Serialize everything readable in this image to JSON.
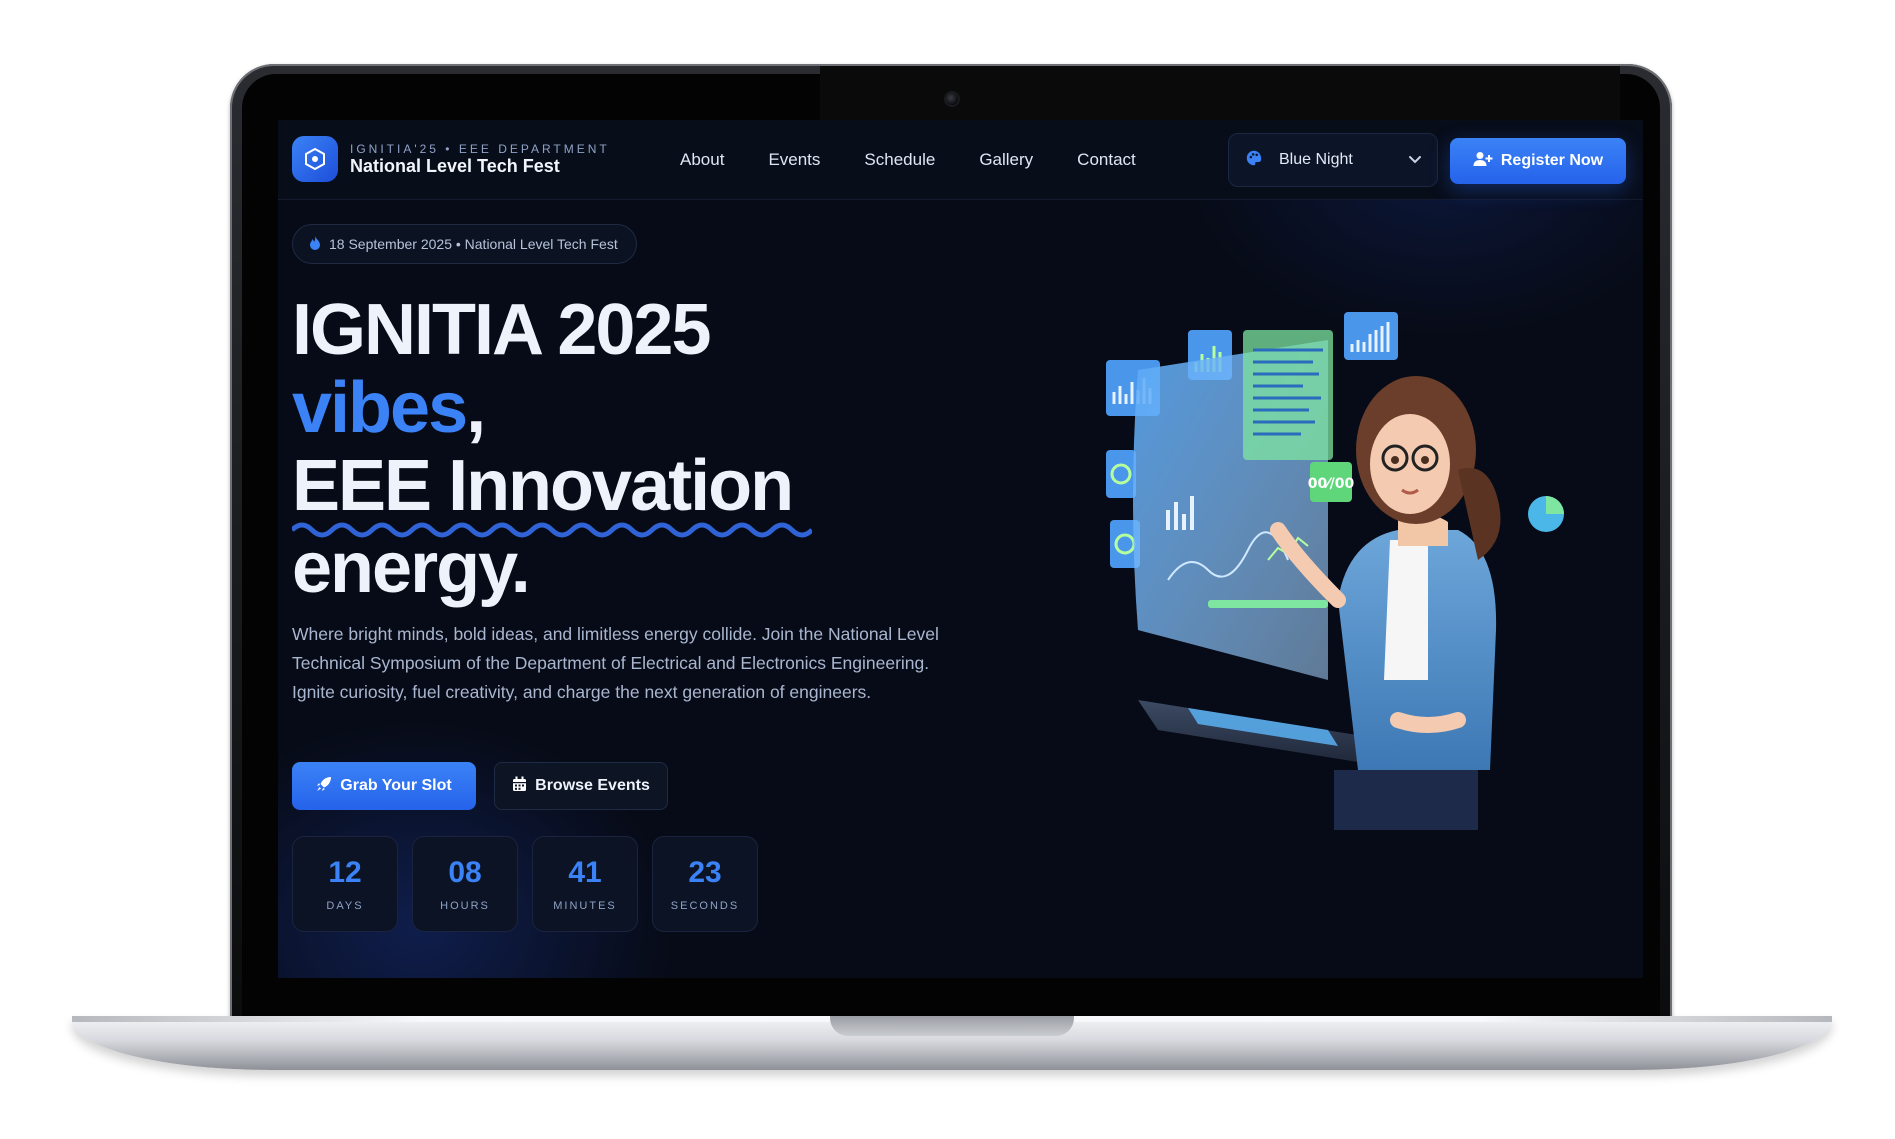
{
  "brand": {
    "eyebrow": "IGNITIA'25 • EEE DEPARTMENT",
    "title": "National Level Tech Fest",
    "logo_icon": "hexagon-logo-icon"
  },
  "nav": {
    "links": [
      "About",
      "Events",
      "Schedule",
      "Gallery",
      "Contact"
    ]
  },
  "theme_select": {
    "value": "Blue Night",
    "icon": "palette-icon"
  },
  "register": {
    "label": "Register Now",
    "icon": "user-plus-icon"
  },
  "hero": {
    "pill": "18 September 2025 • National Level Tech Fest",
    "pill_icon": "fire-icon",
    "line1": "IGNITIA 2025",
    "line2": "vibes",
    "line2_comma": ",",
    "line3": "EEE Innovation",
    "line4": "energy.",
    "description": "Where bright minds, bold ideas, and limitless energy collide. Join the National Level Technical Symposium of the Department of Electrical and Electronics Engineering. Ignite curiosity, fuel creativity, and charge the next generation of engineers.",
    "primary_button": "Grab Your Slot",
    "secondary_button": "Browse Events"
  },
  "countdown": [
    {
      "value": "12",
      "label": "DAYS"
    },
    {
      "value": "08",
      "label": "HOURS"
    },
    {
      "value": "41",
      "label": "MINUTES"
    },
    {
      "value": "23",
      "label": "SECONDS"
    }
  ],
  "illustration": {
    "dashboard_badge": "00⁄/00"
  },
  "colors": {
    "accent": "#3b82f6",
    "background": "#070b17",
    "text": "#eef2fa"
  }
}
